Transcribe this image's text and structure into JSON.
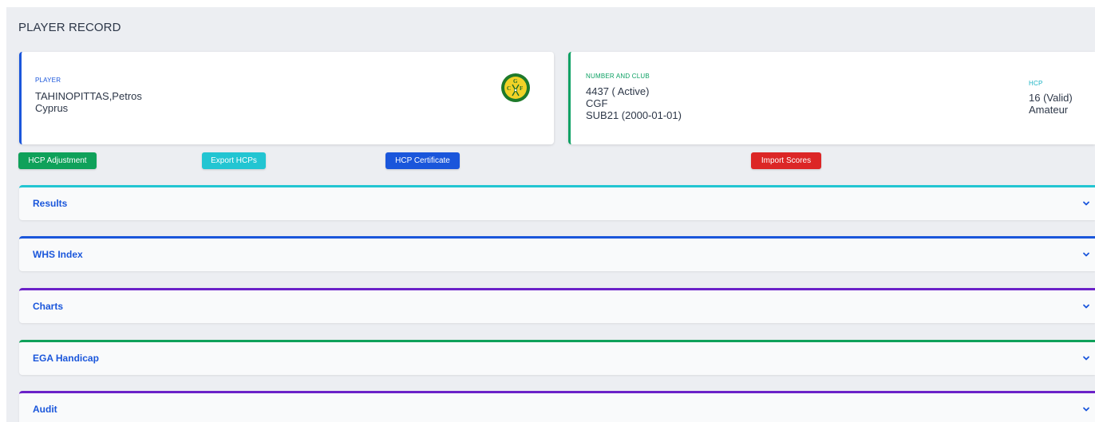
{
  "page": {
    "title": "PLAYER RECORD"
  },
  "player_card": {
    "label": "PLAYER",
    "name": "TAHINOPITTAS,Petros",
    "country": "Cyprus",
    "logo_letters": [
      "G",
      "C",
      "F"
    ]
  },
  "number_card": {
    "label": "NUMBER AND CLUB",
    "number_status": "4437 ( Active)",
    "club": "CGF",
    "category": "SUB21 (2000-01-01)",
    "hcp_label": "HCP",
    "hcp_value": "16 (Valid)",
    "hcp_status": "Amateur"
  },
  "actions": {
    "hcp_adjustment": "HCP Adjustment",
    "export_hcps": "Export HCPs",
    "hcp_certificate": "HCP Certificate",
    "import_scores": "Import Scores"
  },
  "sections": [
    {
      "title": "Results",
      "accent": "#22c5d2",
      "icon": "chevron-down-icon"
    },
    {
      "title": "WHS Index",
      "accent": "#1a56db",
      "icon": "chevron-down-icon"
    },
    {
      "title": "Charts",
      "accent": "#6b21c8",
      "icon": "chevron-down-icon"
    },
    {
      "title": "EGA Handicap",
      "accent": "#0fa15a",
      "icon": "chevron-down-icon"
    },
    {
      "title": "Audit",
      "accent": "#6b21c8",
      "icon": "chevron-down-icon"
    }
  ],
  "colors": {
    "primary": "#1a56db",
    "success": "#0fa15a",
    "info": "#22c5d2",
    "danger": "#dc2626",
    "purple": "#6b21c8",
    "background": "#eceef2"
  }
}
